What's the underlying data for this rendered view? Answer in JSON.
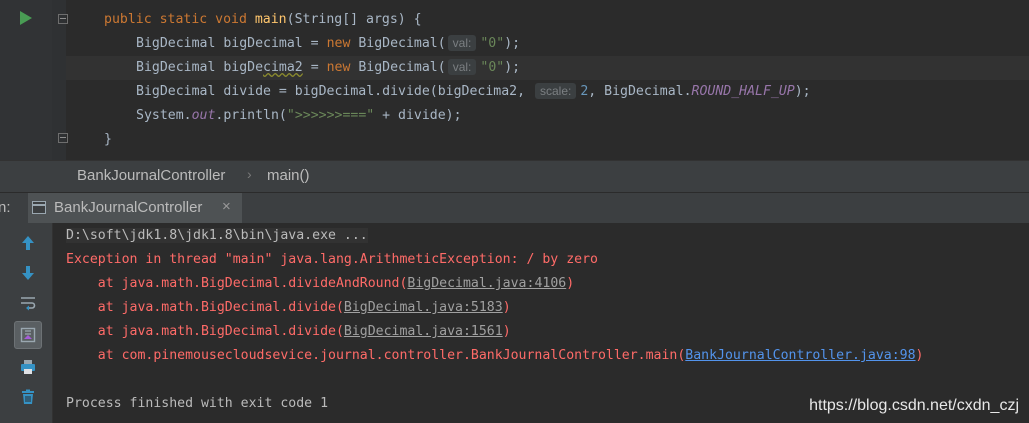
{
  "code": {
    "line1": {
      "kw": "public static void ",
      "fn": "main",
      "rest": "(String[] args) {"
    },
    "line2": {
      "pre": "BigDecimal bigDecimal = ",
      "kw": "new ",
      "cls": "BigDecimal(",
      "hint": "val:",
      "str": "\"0\"",
      "end": ");"
    },
    "line3": {
      "pre1": "BigDecimal bigDe",
      "squig": "cima2",
      "pre2": " = ",
      "kw": "new ",
      "cls": "BigDecimal(",
      "hint": "val:",
      "str": "\"0\"",
      "end": ");"
    },
    "line4": {
      "pre": "BigDecimal divide = bigDecimal.divide(bigDecima2, ",
      "hint": "scale:",
      "num": "2",
      "mid": ", BigDecimal.",
      "static": "ROUND_HALF_UP",
      "end": ");"
    },
    "line5": {
      "pre": "System.",
      "static": "out",
      "mid": ".println(",
      "str": "\">>>>>>===\"",
      "end": " + divide);"
    },
    "line6": {
      "text": "}"
    }
  },
  "breadcrumb": {
    "class_name": "BankJournalController",
    "method": "main()"
  },
  "run_tab": {
    "prefix": "n:",
    "label": "BankJournalController",
    "close": "×"
  },
  "console": {
    "command": "D:\\soft\\jdk1.8\\jdk1.8\\bin\\java.exe ...",
    "exception": "Exception in thread \"main\" java.lang.ArithmeticException: / by zero",
    "frames": [
      {
        "prefix": "    at java.math.BigDecimal.divideAndRound(",
        "link": "BigDecimal.java:4106",
        "suffix": ")"
      },
      {
        "prefix": "    at java.math.BigDecimal.divide(",
        "link": "BigDecimal.java:5183",
        "suffix": ")"
      },
      {
        "prefix": "    at java.math.BigDecimal.divide(",
        "link": "BigDecimal.java:1561",
        "suffix": ")"
      },
      {
        "prefix": "    at com.pinemousecloudsevice.journal.controller.BankJournalController.main(",
        "link": "BankJournalController.java:98",
        "suffix": ")"
      }
    ],
    "finished": "Process finished with exit code 1"
  },
  "toolbar_icons": [
    "arrow-up-icon",
    "arrow-down-icon",
    "soft-wrap-icon",
    "scroll-to-end-icon",
    "print-icon",
    "trash-icon"
  ],
  "watermark": "https://blog.csdn.net/cxdn_czj",
  "colors": {
    "error": "#ff6b68",
    "link": "#5394ec",
    "keyword": "#cc7832",
    "string": "#6a8759",
    "run_green": "#499c54"
  }
}
